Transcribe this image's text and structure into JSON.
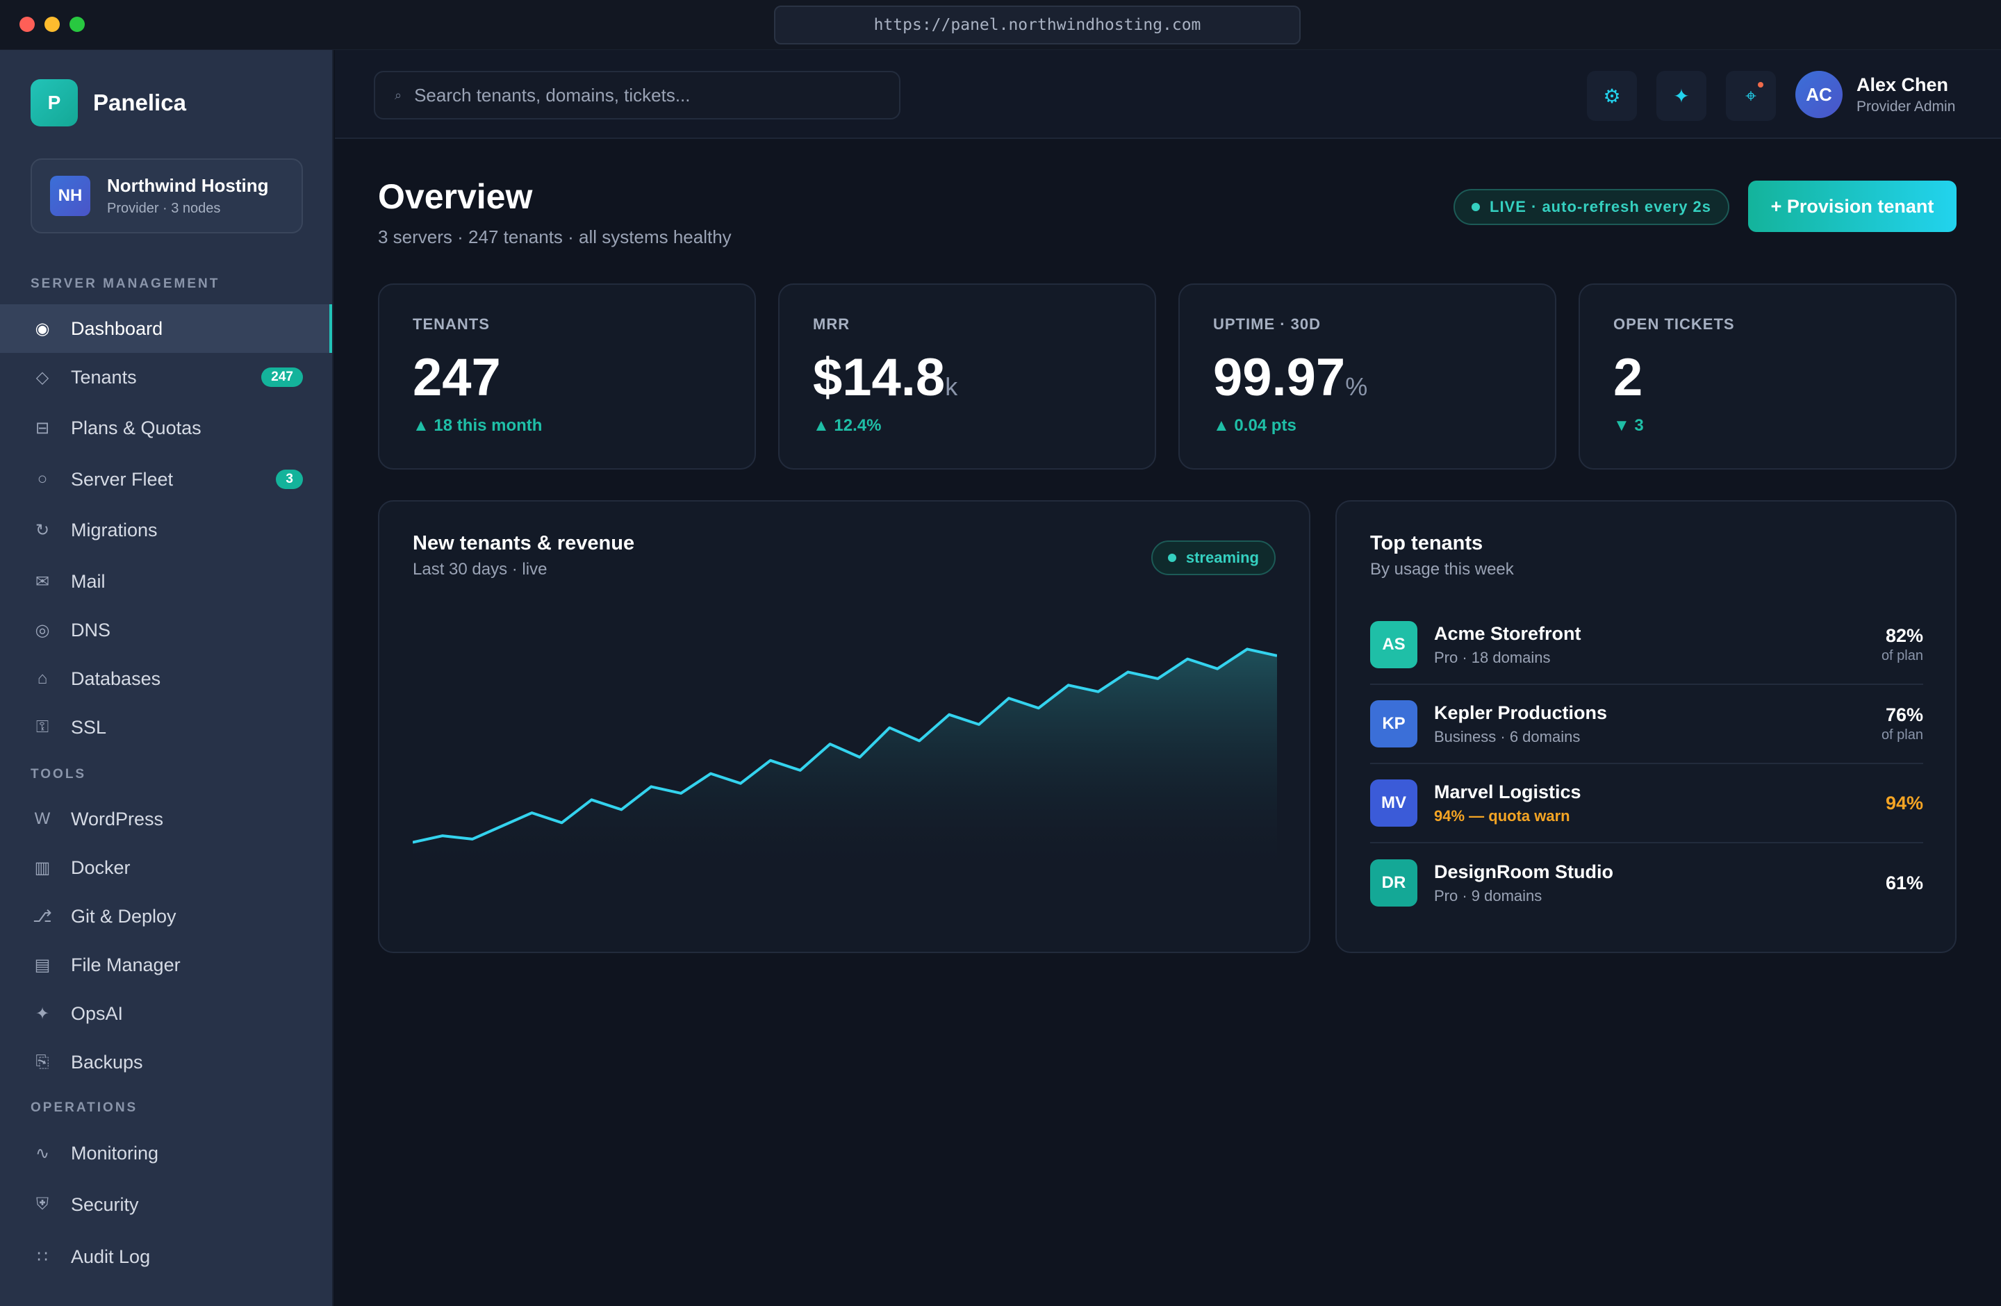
{
  "window": {
    "url": "https://panel.northwindhosting.com"
  },
  "brand": {
    "logo_letter": "P",
    "name": "Panelica"
  },
  "org": {
    "initials": "NH",
    "name": "Northwind Hosting",
    "sub": "Provider · 3 nodes"
  },
  "sidebar": {
    "sections": {
      "server_management": "SERVER MANAGEMENT",
      "tools": "TOOLS",
      "operations": "OPERATIONS"
    },
    "items": [
      {
        "label": "Dashboard",
        "icon": "◉",
        "icon_name": "dashboard-icon"
      },
      {
        "label": "Tenants",
        "icon": "◇",
        "icon_name": "tenants-icon",
        "badge": "247"
      },
      {
        "label": "Plans & Quotas",
        "icon": "⊟",
        "icon_name": "plans-icon"
      },
      {
        "label": "Server Fleet",
        "icon": "○",
        "icon_name": "server-icon",
        "badge": "3"
      },
      {
        "label": "Migrations",
        "icon": "↻",
        "icon_name": "migrations-icon"
      },
      {
        "label": "Mail",
        "icon": "✉",
        "icon_name": "mail-icon"
      },
      {
        "label": "DNS",
        "icon": "◎",
        "icon_name": "dns-icon"
      },
      {
        "label": "Databases",
        "icon": "⌂",
        "icon_name": "database-icon"
      },
      {
        "label": "SSL",
        "icon": "⚿",
        "icon_name": "ssl-icon"
      },
      {
        "label": "WordPress",
        "icon": "W",
        "icon_name": "wordpress-icon"
      },
      {
        "label": "Docker",
        "icon": "▥",
        "icon_name": "docker-icon"
      },
      {
        "label": "Git & Deploy",
        "icon": "⎇",
        "icon_name": "git-icon"
      },
      {
        "label": "File Manager",
        "icon": "▤",
        "icon_name": "file-manager-icon"
      },
      {
        "label": "OpsAI",
        "icon": "✦",
        "icon_name": "sparkle-icon"
      },
      {
        "label": "Backups",
        "icon": "⎘",
        "icon_name": "backups-icon"
      },
      {
        "label": "Monitoring",
        "icon": "∿",
        "icon_name": "monitoring-icon"
      },
      {
        "label": "Security",
        "icon": "⛨",
        "icon_name": "shield-icon"
      },
      {
        "label": "Audit Log",
        "icon": "∷",
        "icon_name": "audit-log-icon"
      }
    ]
  },
  "topbar": {
    "search_placeholder": "Search tenants, domains, tickets...",
    "search_icon": "⌕",
    "buttons": [
      {
        "icon": "⚙",
        "icon_name": "gear-icon"
      },
      {
        "icon": "✦",
        "icon_name": "sparkle-icon"
      },
      {
        "icon": "⌖",
        "icon_name": "notifications-icon"
      }
    ],
    "user": {
      "initials": "AC",
      "name": "Alex Chen",
      "role": "Provider Admin"
    }
  },
  "overview": {
    "title": "Overview",
    "subtitle": "3 servers · 247 tenants · all systems healthy",
    "live_label": "LIVE · auto-refresh every 2s",
    "provision_label": "+ Provision tenant"
  },
  "kpis": [
    {
      "label": "TENANTS",
      "value": "247",
      "suffix": "",
      "delta": "▲ 18 this month"
    },
    {
      "label": "MRR",
      "value": "$14.8",
      "suffix": "k",
      "delta": "▲ 12.4%"
    },
    {
      "label": "UPTIME · 30D",
      "value": "99.97",
      "suffix": "%",
      "delta": "▲ 0.04 pts"
    },
    {
      "label": "OPEN TICKETS",
      "value": "2",
      "suffix": "",
      "delta": "▼ 3"
    }
  ],
  "chart_card": {
    "title": "New tenants & revenue",
    "subtitle": "Last 30 days · live",
    "pill": "streaming"
  },
  "chart_data": {
    "type": "area",
    "title": "New tenants & revenue",
    "x": [
      1,
      2,
      3,
      4,
      5,
      6,
      7,
      8,
      9,
      10,
      11,
      12,
      13,
      14,
      15,
      16,
      17,
      18,
      19,
      20,
      21,
      22,
      23,
      24,
      25,
      26,
      27,
      28,
      29,
      30
    ],
    "series": [
      {
        "values": [
          2,
          4,
          3,
          7,
          11,
          8,
          15,
          12,
          19,
          17,
          23,
          20,
          27,
          24,
          32,
          28,
          37,
          33,
          41,
          38,
          46,
          43,
          50,
          48,
          54,
          52,
          58,
          55,
          61,
          59
        ]
      }
    ],
    "ylim": [
      0,
      70
    ],
    "grid": false,
    "colors": {
      "line": "#34d3ee",
      "fill_top": "#1f5660",
      "fill_bottom": "#131a27"
    }
  },
  "top_tenants": {
    "title": "Top tenants",
    "subtitle": "By usage this week",
    "rows": [
      {
        "initials": "AS",
        "name": "Acme Storefront",
        "sub": "Pro · 18 domains",
        "pct": "82%",
        "of": "of plan",
        "color": "#1fbfa7",
        "warn": false
      },
      {
        "initials": "KP",
        "name": "Kepler Productions",
        "sub": "Business · 6 domains",
        "pct": "76%",
        "of": "of plan",
        "color": "#3b6fd8",
        "warn": false
      },
      {
        "initials": "MV",
        "name": "Marvel Logistics",
        "sub": "94% — quota warn",
        "pct": "94%",
        "of": "",
        "color": "#3b5bd8",
        "warn": true
      },
      {
        "initials": "DR",
        "name": "DesignRoom Studio",
        "sub": "Pro · 9 domains",
        "pct": "61%",
        "of": "",
        "color": "#14a896",
        "warn": false
      }
    ]
  }
}
